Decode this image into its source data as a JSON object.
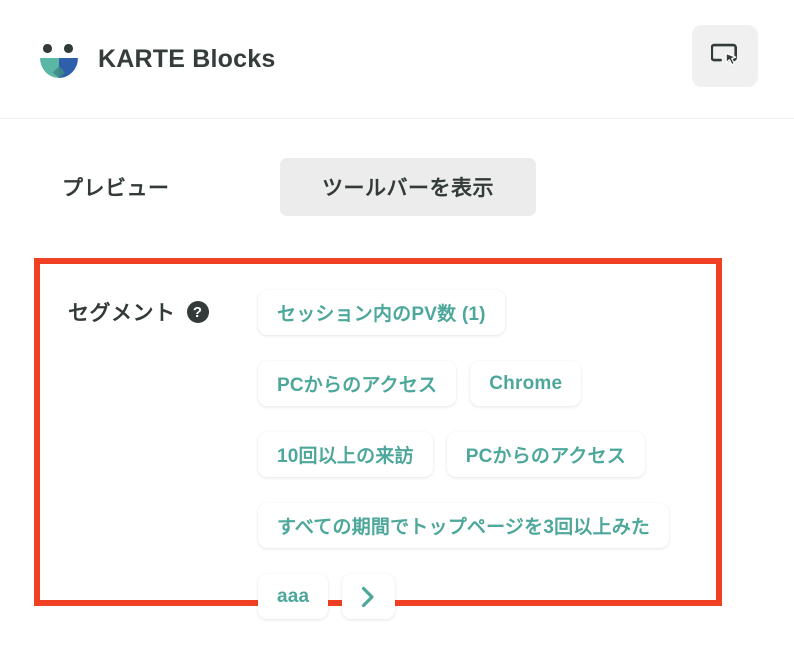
{
  "header": {
    "brand_title": "KARTE Blocks",
    "logo_icon": "karte-smiley-logo",
    "action_button_icon": "select-element-cursor-icon"
  },
  "preview": {
    "label": "プレビュー",
    "toolbar_button_label": "ツールバーを表示"
  },
  "segment": {
    "label": "セグメント",
    "help_icon": "question-mark-icon",
    "next_icon": "chevron-right-icon",
    "chips": [
      {
        "label": "セッション内のPV数 (1)",
        "break_after": true
      },
      {
        "label": "PCからのアクセス",
        "break_after": false
      },
      {
        "label": "Chrome",
        "break_after": true
      },
      {
        "label": "10回以上の来訪",
        "break_after": false
      },
      {
        "label": "PCからのアクセス",
        "break_after": true
      },
      {
        "label": "すべての期間でトップページを3回以上みた",
        "break_after": true
      },
      {
        "label": "aaa",
        "break_after": false
      }
    ]
  },
  "colors": {
    "highlight_border": "#ef4023",
    "chip_text": "#4da79a",
    "text_dark": "#333b3a",
    "button_bg": "#ececec",
    "logo_teal": "#5ab6a5",
    "logo_blue": "#2f5fab"
  }
}
